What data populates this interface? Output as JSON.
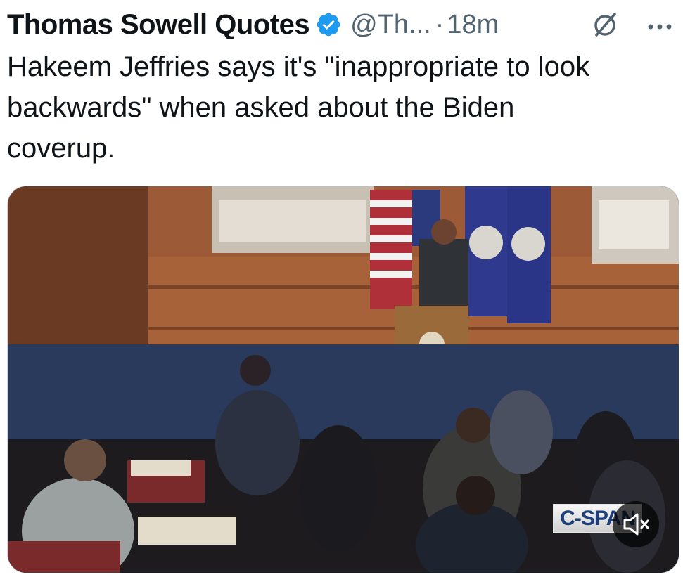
{
  "post": {
    "author_name": "Thomas Sowell Quotes",
    "handle": "@Th...",
    "separator": "·",
    "time": "18m",
    "text": "Hakeem Jeffries says it's \"inappropriate to look\nbackwards\" when asked about the Biden\ncoverup.",
    "verified_color": "#1d9bf0",
    "icons": {
      "verified": "verified-badge-icon",
      "grok": "grok-icon",
      "more": "more-icon",
      "mute": "volume-muted-icon"
    }
  },
  "media": {
    "type": "video",
    "watermark": "C-SPAN"
  }
}
